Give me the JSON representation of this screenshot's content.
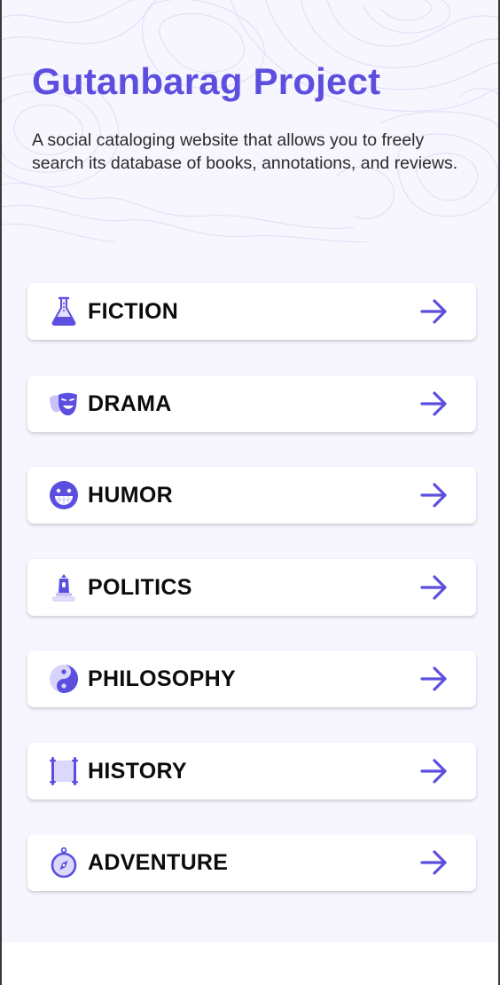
{
  "header": {
    "title": "Gutanbarag Project",
    "description": "A social cataloging website that allows you to freely search its database of books, annotations, and reviews."
  },
  "categories": [
    {
      "label": "FICTION",
      "icon": "flask-icon"
    },
    {
      "label": "DRAMA",
      "icon": "theater-masks-icon"
    },
    {
      "label": "HUMOR",
      "icon": "grin-icon"
    },
    {
      "label": "POLITICS",
      "icon": "monument-icon"
    },
    {
      "label": "PHILOSOPHY",
      "icon": "yin-yang-icon"
    },
    {
      "label": "HISTORY",
      "icon": "scroll-icon"
    },
    {
      "label": "ADVENTURE",
      "icon": "compass-icon"
    }
  ],
  "colors": {
    "accent": "#5c4fe0",
    "accent_light": "#c9c2f7",
    "background": "#f7f5fe",
    "text": "#0c0c0c"
  }
}
